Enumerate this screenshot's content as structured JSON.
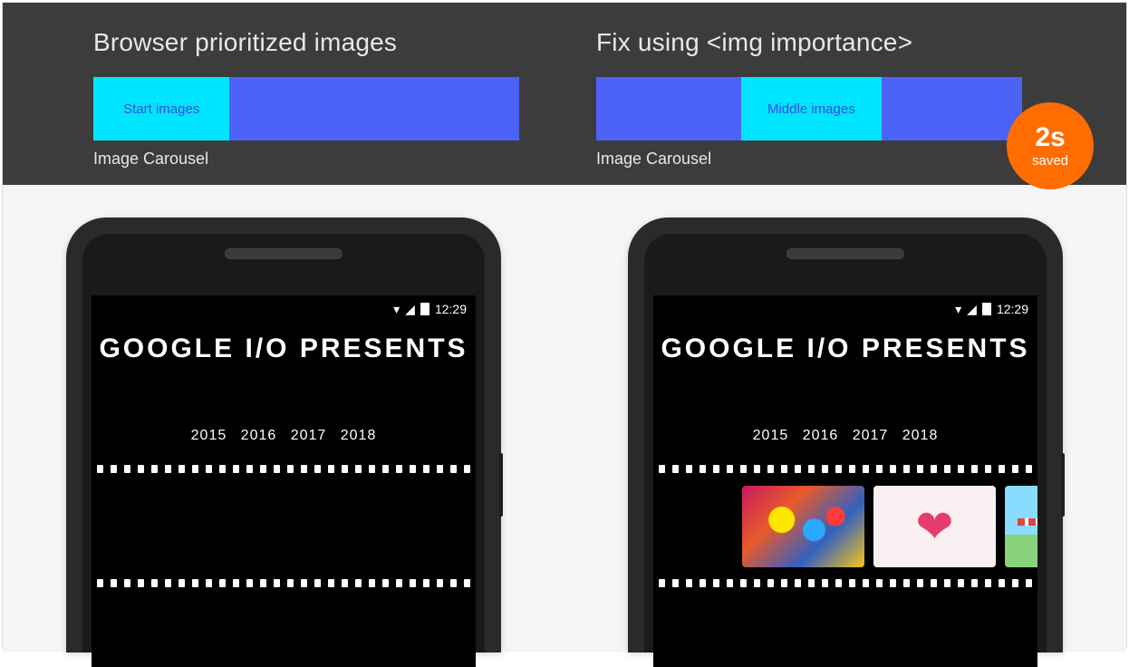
{
  "header": {
    "left": {
      "title": "Browser prioritized images",
      "highlight_label": "Start images",
      "sub": "Image Carousel"
    },
    "right": {
      "title": "Fix using <img importance>",
      "highlight_label": "Middle images",
      "sub": "Image Carousel"
    },
    "badge": {
      "value": "2s",
      "label": "saved"
    }
  },
  "phone": {
    "status_time": "12:29",
    "intro_title": "GOOGLE I/O PRESENTS",
    "years": "2015 2016 2017 2018"
  }
}
